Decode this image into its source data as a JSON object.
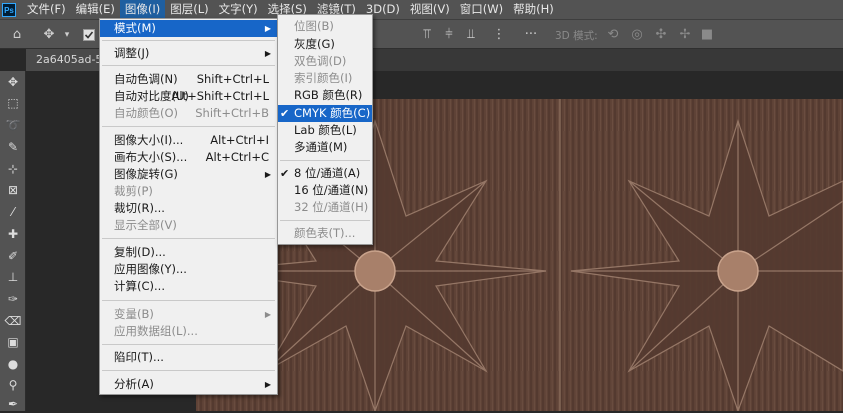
{
  "menubar": {
    "logo": "Ps",
    "items": [
      "文件(F)",
      "编辑(E)",
      "图像(I)",
      "图层(L)",
      "文字(Y)",
      "选择(S)",
      "滤镜(T)",
      "3D(D)",
      "视图(V)",
      "窗口(W)",
      "帮助(H)"
    ],
    "active_index": 2
  },
  "optbar": {
    "mode_3d_label": "3D 模式:"
  },
  "document_tab": {
    "title": "2a6405ad-516"
  },
  "image_menu": {
    "items": [
      {
        "label": "模式(M)",
        "shortcut": "",
        "submenu": true,
        "disabled": false,
        "highlighted": true
      },
      {
        "label": "调整(J)",
        "shortcut": "",
        "submenu": true,
        "disabled": false
      },
      {
        "label": "自动色调(N)",
        "shortcut": "Shift+Ctrl+L",
        "disabled": false
      },
      {
        "label": "自动对比度(U)",
        "shortcut": "Alt+Shift+Ctrl+L",
        "disabled": false
      },
      {
        "label": "自动颜色(O)",
        "shortcut": "Shift+Ctrl+B",
        "disabled": true
      },
      {
        "label": "图像大小(I)...",
        "shortcut": "Alt+Ctrl+I",
        "disabled": false
      },
      {
        "label": "画布大小(S)...",
        "shortcut": "Alt+Ctrl+C",
        "disabled": false
      },
      {
        "label": "图像旋转(G)",
        "shortcut": "",
        "submenu": true,
        "disabled": false
      },
      {
        "label": "裁剪(P)",
        "shortcut": "",
        "disabled": true
      },
      {
        "label": "裁切(R)...",
        "shortcut": "",
        "disabled": false
      },
      {
        "label": "显示全部(V)",
        "shortcut": "",
        "disabled": true
      },
      {
        "label": "复制(D)...",
        "shortcut": "",
        "disabled": false
      },
      {
        "label": "应用图像(Y)...",
        "shortcut": "",
        "disabled": false
      },
      {
        "label": "计算(C)...",
        "shortcut": "",
        "disabled": false
      },
      {
        "label": "变量(B)",
        "shortcut": "",
        "submenu": true,
        "disabled": true
      },
      {
        "label": "应用数据组(L)...",
        "shortcut": "",
        "disabled": true
      },
      {
        "label": "陷印(T)...",
        "shortcut": "",
        "disabled": false
      },
      {
        "label": "分析(A)",
        "shortcut": "",
        "submenu": true,
        "disabled": false
      }
    ]
  },
  "mode_submenu": {
    "items": [
      {
        "label": "位图(B)",
        "disabled": true
      },
      {
        "label": "灰度(G)",
        "disabled": false
      },
      {
        "label": "双色调(D)",
        "disabled": true
      },
      {
        "label": "索引颜色(I)",
        "disabled": true
      },
      {
        "label": "RGB 颜色(R)",
        "disabled": false
      },
      {
        "label": "CMYK 颜色(C)",
        "disabled": false,
        "checked": true,
        "highlighted": true
      },
      {
        "label": "Lab 颜色(L)",
        "disabled": false
      },
      {
        "label": "多通道(M)",
        "disabled": false
      },
      {
        "label": "8 位/通道(A)",
        "disabled": false,
        "checked": true
      },
      {
        "label": "16 位/通道(N)",
        "disabled": false
      },
      {
        "label": "32 位/通道(H)",
        "disabled": true
      },
      {
        "label": "颜色表(T)...",
        "disabled": true
      }
    ],
    "check_glyph": "✔"
  },
  "colors": {
    "menubar_bg": "#535353",
    "menu_bg": "#f0f0f0",
    "highlight": "#1766c8",
    "wood_dark": "#4a3128",
    "wood_light": "#7a5a4c"
  }
}
